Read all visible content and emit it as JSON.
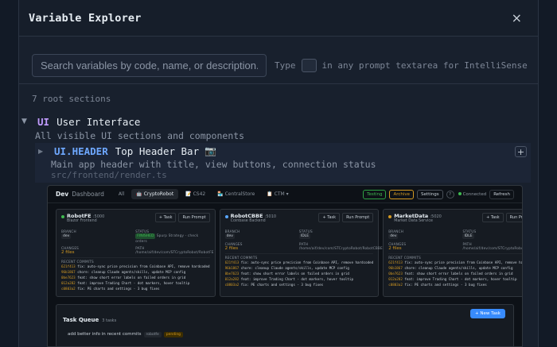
{
  "modal": {
    "title": "Variable Explorer",
    "close_icon": "×"
  },
  "search": {
    "placeholder": "Search variables by code, name, or description...",
    "hint_before": "Type",
    "hint_after": "in any prompt textarea for IntelliSense"
  },
  "root_count": "7 root sections",
  "section": {
    "caret": "▼",
    "code": "UI",
    "name": "User Interface",
    "description": "All visible UI sections and components"
  },
  "subsection": {
    "caret": "▶",
    "code": "UI.HEADER",
    "name": "Top Header Bar",
    "icon": "camera-icon",
    "icon_glyph": "📷",
    "description": "Main app header with title, view buttons, connection status",
    "path": "src/frontend/render.ts",
    "add_glyph": "+"
  },
  "preview": {
    "brand": "Dev",
    "brand2": "Dashboard",
    "tabs": [
      "All",
      "🤖 CryptoRobot",
      "📝 CS42",
      "🏪 CentralStore",
      "📋 CTM ▾"
    ],
    "active_tab": 1,
    "pills": [
      "Testing",
      "Archive",
      "Settings"
    ],
    "help": "?",
    "connected": "Connected",
    "refresh": "Refresh",
    "task_btn": "+ Task",
    "run_btn": "Run Prompt",
    "cards": [
      {
        "name": "RobotFE",
        "port": ":5000",
        "sub": "Blazor Frontend",
        "dot": "#3fb950",
        "branch_label": "BRANCH",
        "branch": "dev",
        "status_label": "STATUS",
        "status": "FINISHED",
        "status_note": "Spurp Strategy - check orders",
        "changes_label": "CHANGES",
        "changes": "2 files",
        "path_label": "PATH",
        "path": "/home/aif/dev/com/STCryptoRobot/RobotFE",
        "commits_label": "RECENT COMMITS",
        "commits": [
          [
            "621f413",
            "fix: auto-sync price precision from Coinbase API, remove hardcoded"
          ],
          [
            "96b1867",
            "chore: cleanup Claude agents/skills, update MCP config"
          ],
          [
            "0be7623",
            "feat: show short error labels on failed orders in grid"
          ],
          [
            "012a282",
            "feat: improve Trading Chart - dot markers, hover tooltip"
          ],
          [
            "c0803a2",
            "fix: PE charts and settings - 3 bug fixes"
          ]
        ]
      },
      {
        "name": "RobotCBBE",
        "port": ":5010",
        "sub": "Coinbase Backend",
        "dot": "#58a6ff",
        "branch_label": "BRANCH",
        "branch": "dev",
        "status_label": "STATUS",
        "status": "IDLE",
        "status_note": "",
        "changes_label": "CHANGES",
        "changes": "2 files",
        "path_label": "PATH",
        "path": "/home/aif/dev/com/STCryptoRobot/RobotCBBE",
        "commits_label": "RECENT COMMITS",
        "commits": [
          [
            "621f413",
            "fix: auto-sync price precision from Coinbase API, remove hardcoded"
          ],
          [
            "96b1867",
            "chore: cleanup Claude agents/skills, update MCP config"
          ],
          [
            "0be7623",
            "feat: show short error labels on failed orders in grid"
          ],
          [
            "012a282",
            "feat: improve Trading Chart - dot markers, hover tooltip"
          ],
          [
            "c0803a2",
            "fix: PE charts and settings - 3 bug fixes"
          ]
        ]
      },
      {
        "name": "MarketData",
        "port": ":5020",
        "sub": "Market Data Service",
        "dot": "#d29922",
        "branch_label": "BRANCH",
        "branch": "dev",
        "status_label": "STATUS",
        "status": "IDLE",
        "status_note": "",
        "changes_label": "CHANGES",
        "changes": "2 files",
        "path_label": "PATH",
        "path": "/home/aif/dev/com/STCryptoRobot/MarketDataService",
        "commits_label": "RECENT COMMITS",
        "commits": [
          [
            "621f413",
            "fix: auto-sync price precision from Coinbase API, remove hardcoded"
          ],
          [
            "96b1867",
            "chore: cleanup Claude agents/skills, update MCP config"
          ],
          [
            "0be7623",
            "feat: show short error labels on failed orders in grid"
          ],
          [
            "012a282",
            "feat: improve Trading Chart - dot markers, hover tooltip"
          ],
          [
            "c0803a2",
            "fix: PE charts and settings - 3 bug fixes"
          ]
        ]
      }
    ],
    "queue": {
      "title": "Task Queue",
      "count": "3 tasks",
      "new_task": "+ New Task",
      "item": "add better info in recent commits",
      "tags": [
        "robotfe",
        "pending"
      ]
    }
  }
}
